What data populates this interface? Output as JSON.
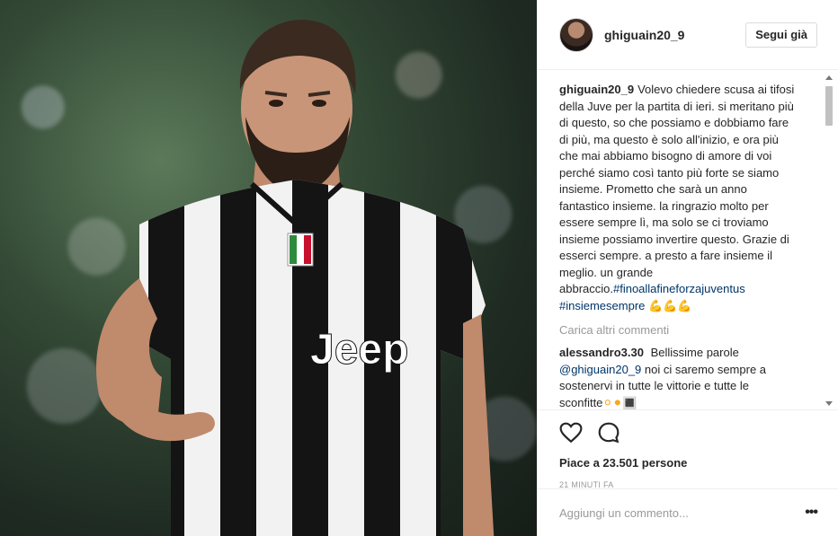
{
  "post": {
    "image_alt": "Gonzalo Higuaín in Juventus Jeep jersey"
  },
  "header": {
    "username": "ghiguain20_9",
    "follow_label": "Segui già"
  },
  "caption": {
    "username": "ghiguain20_9",
    "text": "Volevo chiedere scusa ai tifosi della Juve per la partita di ieri. si meritano più di questo, so che possiamo e dobbiamo fare di più, ma questo è solo all'inizio, e ora più che mai abbiamo bisogno di amore di voi perché siamo così tanto più forte se siamo insieme. Prometto che sarà un anno fantastico insieme. la ringrazio molto per essere sempre lì, ma solo se ci troviamo insieme possiamo invertire questo. Grazie di esserci sempre. a presto a fare insieme il meglio. un grande abbraccio.",
    "hashtag1": "#finoallafineforzajuventus",
    "hashtag2": "#insiemesempre",
    "emojis": "💪💪💪"
  },
  "load_more": "Carica altri commenti",
  "comments": [
    {
      "username": "alessandro3.30",
      "text_before": "Bellissime parole",
      "mention": "@ghiguain20_9",
      "text_after": "noi ci saremo sempre a sostenervi in tutte le vittorie e tutte le sconfitte",
      "emojis": "⚪⚫🔳"
    }
  ],
  "actions": {
    "likes_text": "Piace a 23.501 persone",
    "timestamp": "21 MINUTI FA"
  },
  "comment_input": {
    "placeholder": "Aggiungi un commento...",
    "more_label": "•••"
  }
}
